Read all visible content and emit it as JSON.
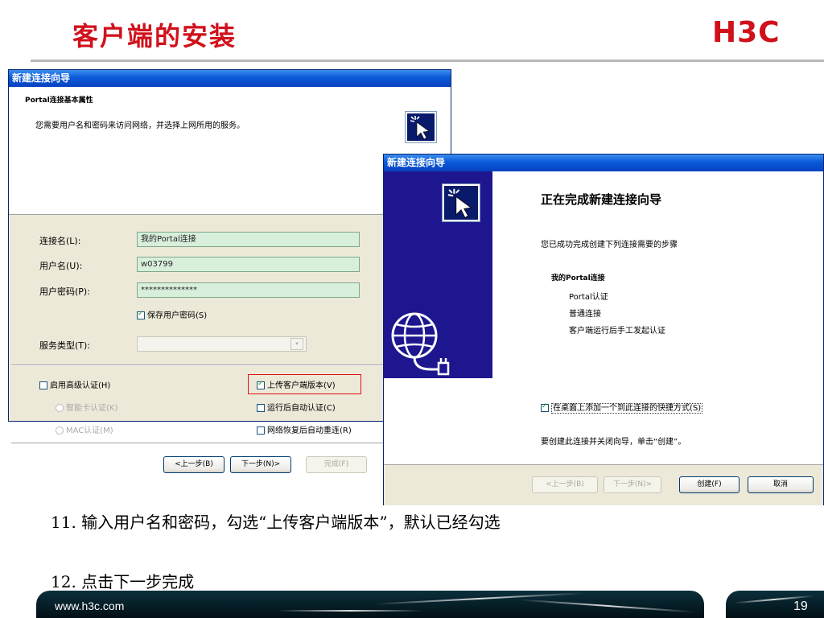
{
  "slide": {
    "title": "客户端的安装",
    "logo": "H3C",
    "captions": [
      "11. 输入用户名和密码，勾选“上传客户端版本”，默认已经勾选",
      "12. 点击下一步完成"
    ],
    "footer_url": "www.h3c.com",
    "page_number": "19"
  },
  "dialog1": {
    "title": "新建连接向导",
    "header_title": "Portal连接基本属性",
    "header_desc": "您需要用户名和密码来访问网络，并选择上网所用的服务。",
    "conn_name_label": "连接名(L):",
    "conn_name_value": "我的Portal连接",
    "username_label": "用户名(U):",
    "username_value": "w03799",
    "password_label": "用户密码(P):",
    "password_value": "**************",
    "save_password": "保存用户密码(S)",
    "service_label": "服务类型(T):",
    "service_value": "",
    "advanced_auth": "启用高级认证(H)",
    "smartcard_auth": "智能卡认证(K)",
    "mac_auth": "MAC认证(M)",
    "upload_version": "上传客户端版本(V)",
    "auto_auth": "运行后自动认证(C)",
    "reconnect": "网络恢复后自动重连(R)",
    "back_button": "<上一步(B)",
    "next_button": "下一步(N)>",
    "finish_button": "完成(F)"
  },
  "dialog2": {
    "title": "新建连接向导",
    "heading": "正在完成新建连接向导",
    "desc": "您已成功完成创建下列连接需要的步骤",
    "connection_name": "我的Portal连接",
    "items": [
      "Portal认证",
      "普通连接",
      "客户端运行后手工发起认证"
    ],
    "shortcut": "在桌面上添加一个到此连接的快捷方式(S)",
    "instruction": "要创建此连接并关闭向导，单击“创建”。",
    "back_button": "<上一步(B)",
    "next_button": "下一步(N)>",
    "create_button": "创建(F)",
    "cancel_button": "取消"
  },
  "colors": {
    "brand_red": "#d0111b",
    "xp_blue": "#0a5ad8",
    "wizard_blue": "#1e168f",
    "field_green": "#d8efdc"
  },
  "icons": [
    "wizard-cursor-icon",
    "globe-network-icon",
    "checkbox-icon",
    "dropdown-arrow-icon"
  ]
}
